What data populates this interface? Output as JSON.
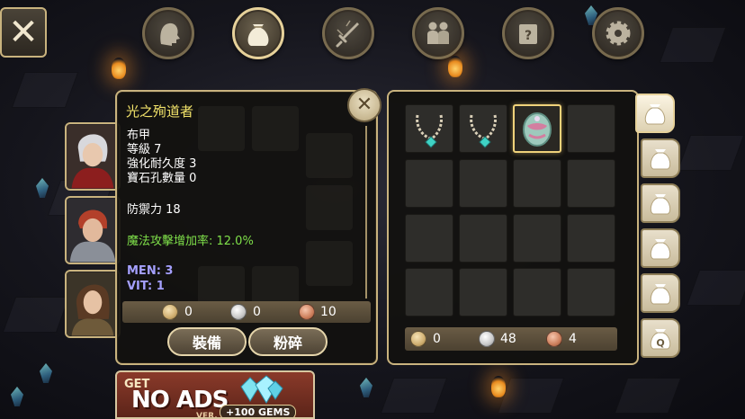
{
  "top_tabs": [
    {
      "name": "character",
      "icon": "head-icon",
      "active": false
    },
    {
      "name": "inventory",
      "icon": "bag-icon",
      "active": true
    },
    {
      "name": "skills",
      "icon": "sword-icon",
      "active": false
    },
    {
      "name": "party",
      "icon": "group-icon",
      "active": false
    },
    {
      "name": "quest",
      "icon": "scroll-icon",
      "active": false
    },
    {
      "name": "settings",
      "icon": "gear-icon",
      "active": false
    }
  ],
  "item_detail": {
    "name": "光之殉道者",
    "type": "布甲",
    "level": "等級 7",
    "durability": "強化耐久度 3",
    "gem_slots": "寶石孔數量 0",
    "defense": "防禦力 18",
    "magic_bonus": "魔法攻擊增加率: 12.0%",
    "men": "MEN: 3",
    "vit": "VIT: 1",
    "price": {
      "gold": "0",
      "silver": "0",
      "copper": "10"
    },
    "equip_label": "裝備",
    "crush_label": "粉碎"
  },
  "inventory": {
    "slots": [
      {
        "item": "necklace-icon"
      },
      {
        "item": "necklace-icon"
      },
      {
        "item": "egg-armor-icon",
        "selected": true
      },
      {
        "item": ""
      }
    ],
    "currency": {
      "gold": "0",
      "silver": "48",
      "copper": "4"
    }
  },
  "side_tabs": [
    "bag-1",
    "bag-2",
    "bag-3",
    "bag-4",
    "bag-5",
    "bag-q"
  ],
  "side_tab_q_label": "Q",
  "ad": {
    "get": "GET",
    "no_ads": "NO ADS",
    "ver": "VER.",
    "gems": "+100 GEMS"
  },
  "colors": {
    "frame_gold": "#c9b37e",
    "item_name": "#f2e36a",
    "bonus_green": "#7fe04a",
    "stat_purple": "#a5a0ff"
  }
}
